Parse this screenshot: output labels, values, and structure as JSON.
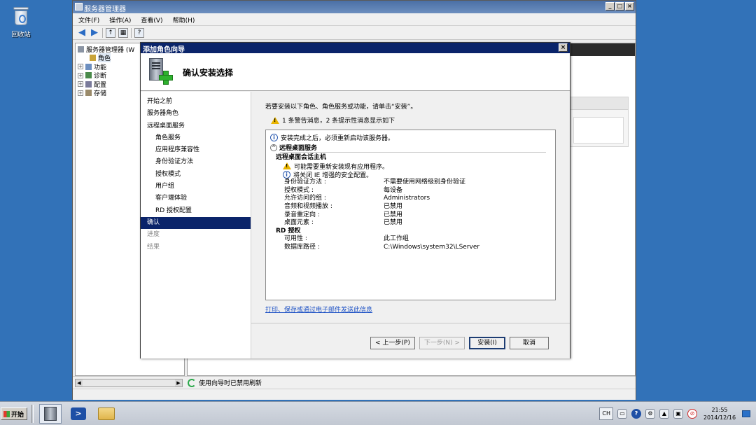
{
  "desktop": {
    "recycle_bin_label": "回收站"
  },
  "server_manager": {
    "title": "服务器管理器",
    "menu": [
      "文件(F)",
      "操作(A)",
      "查看(V)",
      "帮助(H)"
    ],
    "tree": {
      "root": "服务器管理器 (W",
      "items": [
        "角色",
        "功能",
        "诊断",
        "配置",
        "存储"
      ]
    },
    "status_text": "使用向导时已禁用刷新"
  },
  "wizard": {
    "title": "添加角色向导",
    "header_title": "确认安装选择",
    "nav": [
      {
        "label": "开始之前",
        "level": 0,
        "state": "done"
      },
      {
        "label": "服务器角色",
        "level": 0,
        "state": "done"
      },
      {
        "label": "远程桌面服务",
        "level": 0,
        "state": "done"
      },
      {
        "label": "角色服务",
        "level": 1,
        "state": "done"
      },
      {
        "label": "应用程序兼容性",
        "level": 1,
        "state": "done"
      },
      {
        "label": "身份验证方法",
        "level": 1,
        "state": "done"
      },
      {
        "label": "授权模式",
        "level": 1,
        "state": "done"
      },
      {
        "label": "用户组",
        "level": 1,
        "state": "done"
      },
      {
        "label": "客户端体验",
        "level": 1,
        "state": "done"
      },
      {
        "label": "RD 授权配置",
        "level": 1,
        "state": "done"
      },
      {
        "label": "确认",
        "level": 0,
        "state": "active"
      },
      {
        "label": "进度",
        "level": 0,
        "state": "future"
      },
      {
        "label": "结果",
        "level": 0,
        "state": "future"
      }
    ],
    "intro": "若要安装以下角色、角色服务或功能，请单击“安装”。",
    "warning_summary": "1 条警告消息，2 条提示性消息显示如下",
    "info_restart": "安装完成之后，必须重新启动该服务器。",
    "section_title": "远程桌面服务",
    "session_host": {
      "title": "远程桌面会话主机",
      "warn": "可能需要重新安装现有应用程序。",
      "info": "将关闭 IE 增强的安全配置。",
      "props": [
        {
          "k": "身份验证方法 :",
          "v": "不需要使用网络级别身份验证"
        },
        {
          "k": "授权模式 :",
          "v": "每设备"
        },
        {
          "k": "允许访问的组 :",
          "v": "Administrators"
        },
        {
          "k": "音频和视频播放 :",
          "v": "已禁用"
        },
        {
          "k": "录音重定向 :",
          "v": "已禁用"
        },
        {
          "k": "桌面元素 :",
          "v": "已禁用"
        }
      ]
    },
    "licensing": {
      "title": "RD 授权",
      "props": [
        {
          "k": "可用性 :",
          "v": "此工作组"
        },
        {
          "k": "数据库路径 :",
          "v": "C:\\Windows\\system32\\LServer"
        }
      ]
    },
    "print_link": "打印、保存或通过电子邮件发送此信息",
    "buttons": {
      "back": "< 上一步(P)",
      "next": "下一步(N) >",
      "install": "安装(I)",
      "cancel": "取消"
    }
  },
  "taskbar": {
    "start": "开始",
    "lang": "CH",
    "time": "21:55",
    "date": "2014/12/16"
  },
  "colors": {
    "selection": "#0a246a",
    "link": "#1a4fc4",
    "desktop": "#3272b8"
  }
}
